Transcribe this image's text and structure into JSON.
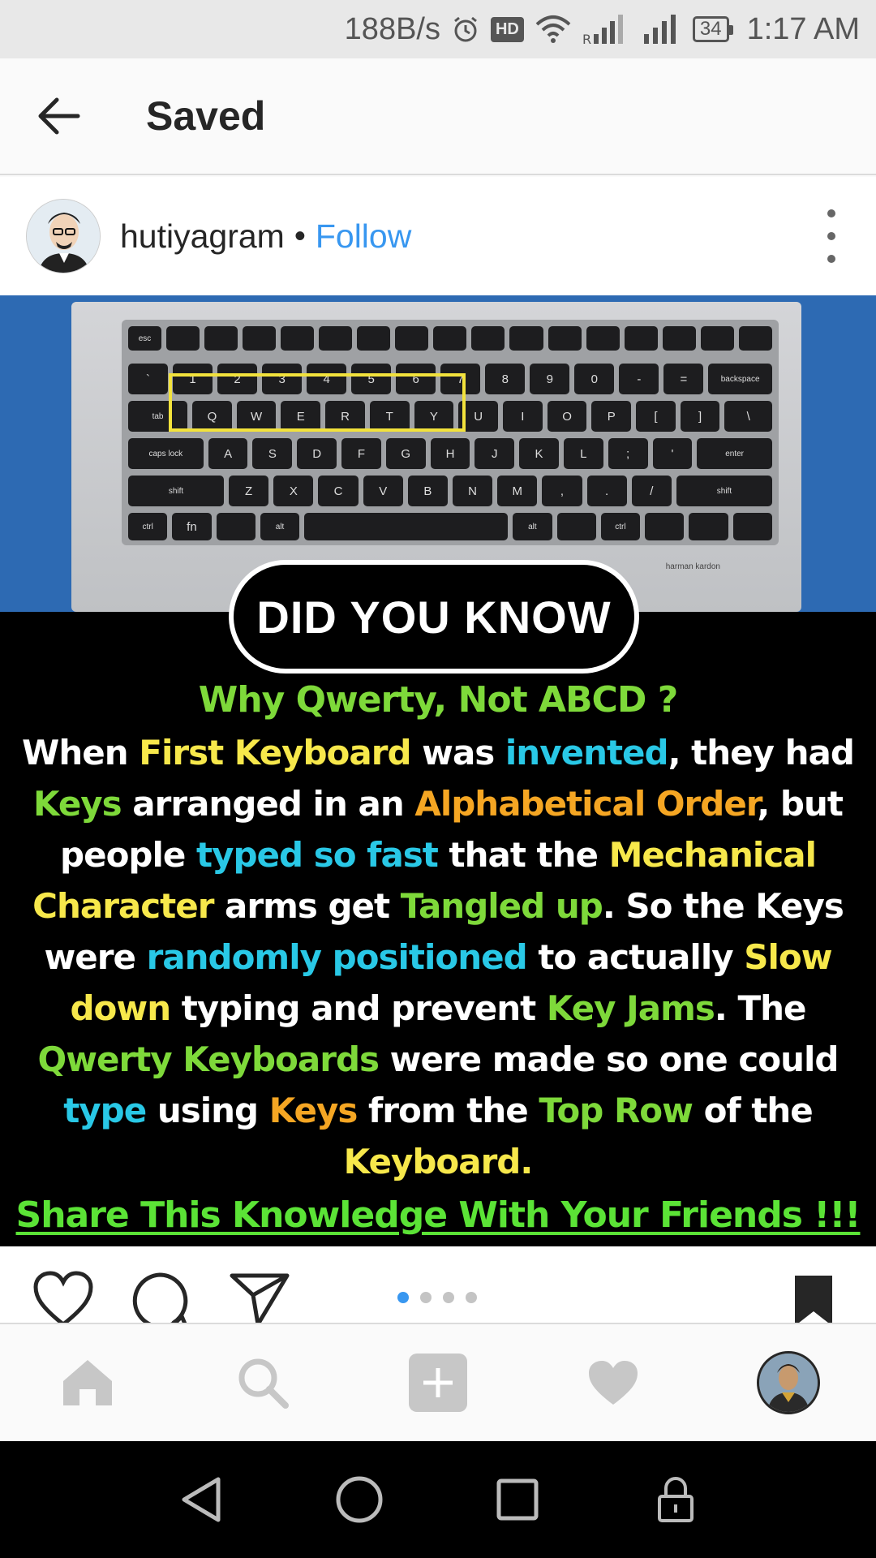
{
  "status_bar": {
    "net_speed": "188B/s",
    "hd": "HD",
    "battery": "34",
    "time": "1:17 AM"
  },
  "header": {
    "title": "Saved"
  },
  "post": {
    "username": "hutiyagram",
    "separator": "•",
    "follow_label": "Follow",
    "image": {
      "badge": "DID YOU KNOW",
      "subtitle": "Why Qwerty, Not ABCD ?",
      "body": [
        {
          "text": "When ",
          "color": "white"
        },
        {
          "text": "First Keyboard",
          "color": "yellow"
        },
        {
          "text": " was ",
          "color": "white"
        },
        {
          "text": "invented",
          "color": "blue"
        },
        {
          "text": ", they had ",
          "color": "white"
        },
        {
          "text": "Keys",
          "color": "green"
        },
        {
          "text": " arranged in an ",
          "color": "white"
        },
        {
          "text": "Alphabetical Order",
          "color": "orange"
        },
        {
          "text": ", but people ",
          "color": "white"
        },
        {
          "text": "typed so fast",
          "color": "blue"
        },
        {
          "text": " that the ",
          "color": "white"
        },
        {
          "text": "Mechanical Character",
          "color": "yellow"
        },
        {
          "text": " arms get ",
          "color": "white"
        },
        {
          "text": "Tangled up",
          "color": "green"
        },
        {
          "text": ". So the Keys were ",
          "color": "white"
        },
        {
          "text": "randomly positioned",
          "color": "blue"
        },
        {
          "text": " to actually ",
          "color": "white"
        },
        {
          "text": "Slow down",
          "color": "yellow"
        },
        {
          "text": " typing and prevent ",
          "color": "white"
        },
        {
          "text": "Key Jams",
          "color": "green"
        },
        {
          "text": ". The ",
          "color": "white"
        },
        {
          "text": "Qwerty Keyboards",
          "color": "green"
        },
        {
          "text": " were made so one could ",
          "color": "white"
        },
        {
          "text": "type",
          "color": "blue"
        },
        {
          "text": " using ",
          "color": "white"
        },
        {
          "text": "Keys",
          "color": "orange"
        },
        {
          "text": " from the ",
          "color": "white"
        },
        {
          "text": "Top Row",
          "color": "green"
        },
        {
          "text": " of the ",
          "color": "white"
        },
        {
          "text": "Keyboard.",
          "color": "yellow"
        }
      ],
      "share_line": "Share This Knowledge With Your Friends !!!",
      "keyboard_brand": "harman kardon",
      "keyboard_rows": [
        [
          "esc",
          "",
          "",
          "",
          "",
          "",
          "",
          "",
          "",
          "",
          "",
          "",
          "",
          "",
          "",
          "",
          ""
        ],
        [
          "`",
          "1",
          "2",
          "3",
          "4",
          "5",
          "6",
          "7",
          "8",
          "9",
          "0",
          "-",
          "=",
          "backspace"
        ],
        [
          "tab",
          "Q",
          "W",
          "E",
          "R",
          "T",
          "Y",
          "U",
          "I",
          "O",
          "P",
          "[",
          "]",
          "\\"
        ],
        [
          "caps lock",
          "A",
          "S",
          "D",
          "F",
          "G",
          "H",
          "J",
          "K",
          "L",
          ";",
          "'",
          "enter"
        ],
        [
          "shift",
          "Z",
          "X",
          "C",
          "V",
          "B",
          "N",
          "M",
          ",",
          ".",
          "/",
          "shift"
        ],
        [
          "ctrl",
          "fn",
          "",
          "alt",
          "",
          "alt",
          "",
          "ctrl",
          "",
          "",
          ""
        ]
      ]
    },
    "carousel": {
      "count": 4,
      "active": 0
    }
  },
  "colors": {
    "white": "#ffffff",
    "yellow": "#f7e84b",
    "blue": "#29c8e6",
    "orange": "#f5a623",
    "green": "#7ed93a",
    "link": "#3897f0"
  },
  "icons": {
    "back": "arrow-left-icon",
    "more": "more-vertical-icon",
    "like": "heart-outline-icon",
    "comment": "comment-icon",
    "share": "send-icon",
    "save": "bookmark-filled-icon",
    "home": "home-icon",
    "search": "search-icon",
    "add": "add-post-icon",
    "activity": "heart-filled-icon",
    "profile": "profile-avatar",
    "sys_back": "triangle-back-icon",
    "sys_home": "circle-home-icon",
    "sys_recents": "square-recents-icon",
    "sys_lock": "lock-icon"
  }
}
